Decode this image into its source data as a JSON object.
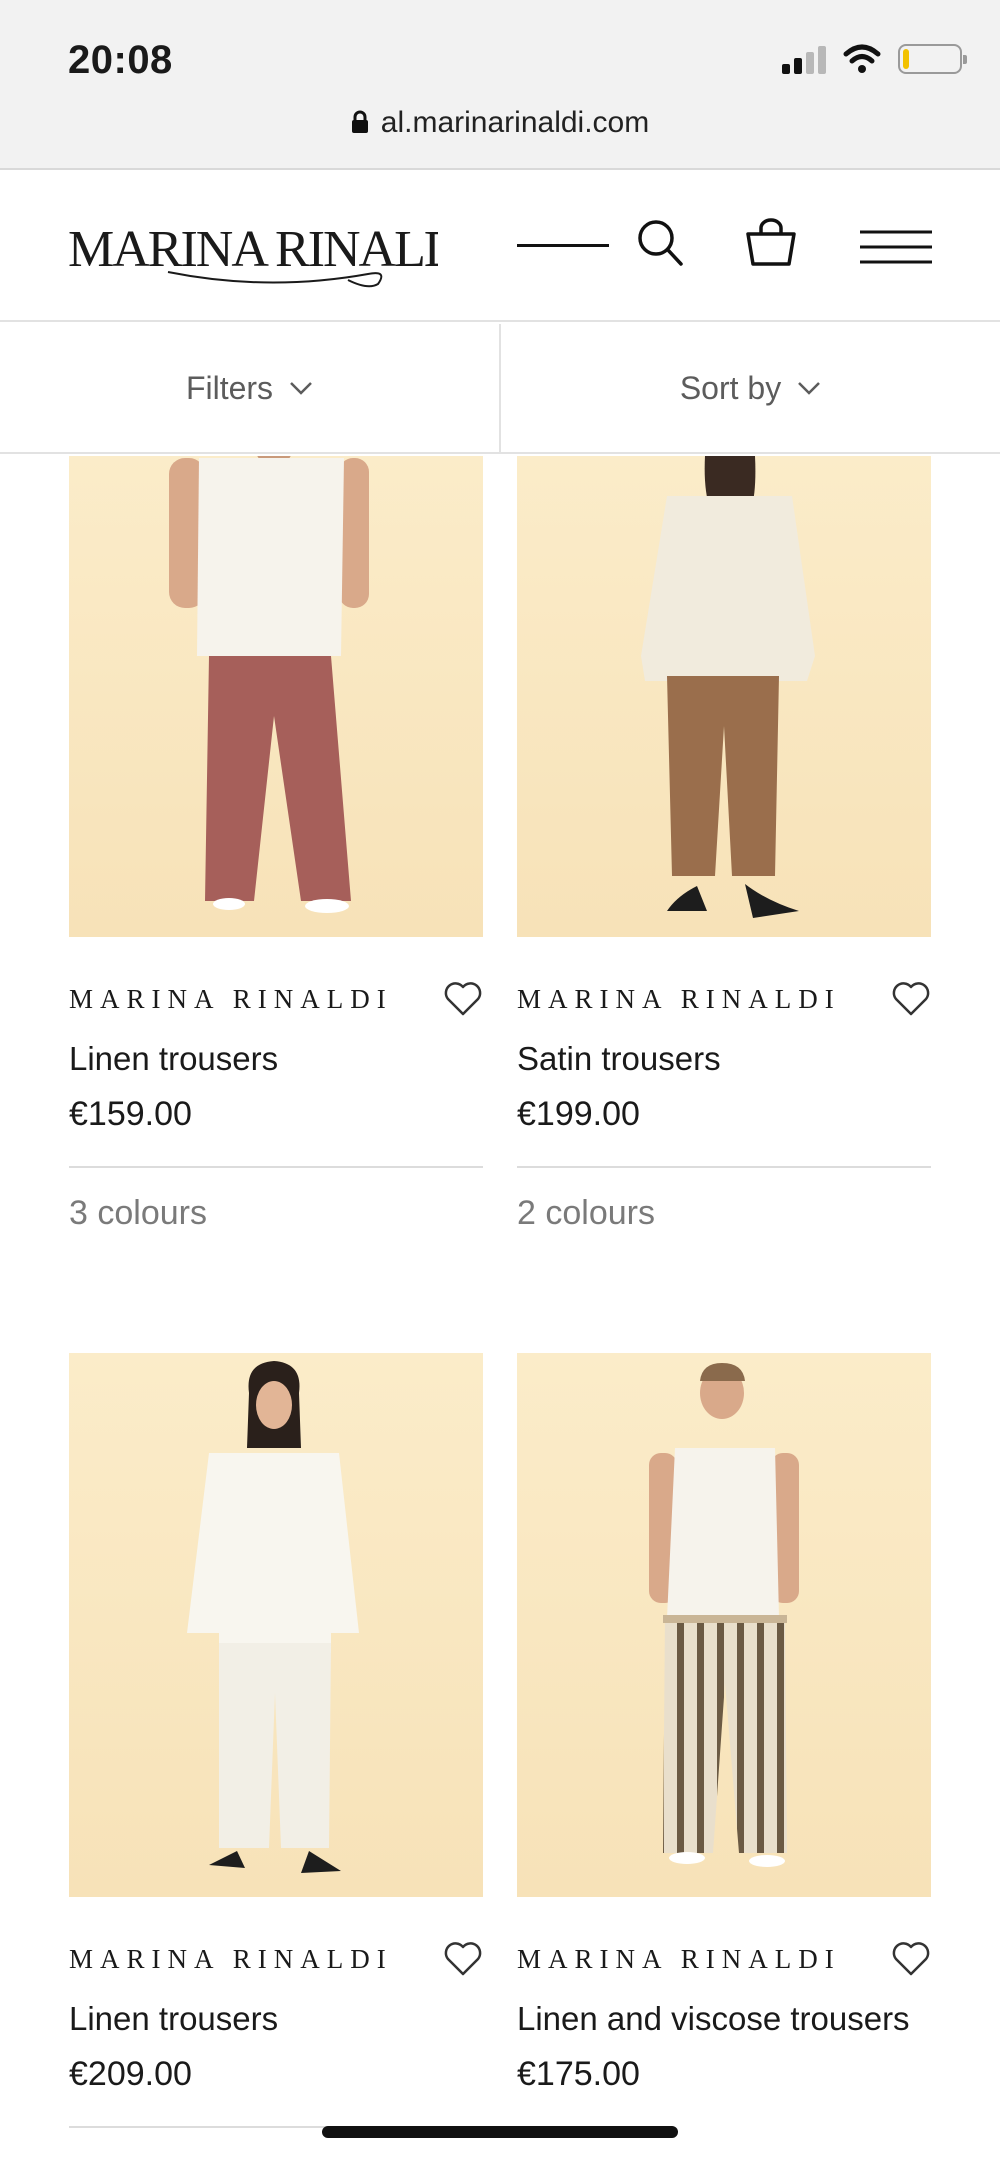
{
  "status_bar": {
    "time": "20:08"
  },
  "browser": {
    "url": "al.marinarinaldi.com"
  },
  "header": {
    "logo_text": "MARINA RINALDI",
    "icons": [
      "search-icon",
      "shopping-bag-icon",
      "menu-icon"
    ]
  },
  "filters": {
    "filters_label": "Filters",
    "sort_label": "Sort by"
  },
  "products": [
    {
      "brand": "MARINA RINALDI",
      "name": "Linen trousers",
      "price": "€159.00",
      "colours": "3 colours",
      "top_color": "#f6f3ec",
      "bottom_color": "#a65f5a"
    },
    {
      "brand": "MARINA RINALDI",
      "name": "Satin trousers",
      "price": "€199.00",
      "colours": "2 colours",
      "top_color": "#f1ebdd",
      "bottom_color": "#9a6e4c"
    },
    {
      "brand": "MARINA RINALDI",
      "name": "Linen trousers",
      "price": "€209.00",
      "top_color": "#f8f6ef",
      "bottom_color": "#f2efe6"
    },
    {
      "brand": "MARINA RINALDI",
      "name": "Linen and viscose trousers",
      "price": "€175.00",
      "top_color": "#f6f3ec",
      "bottom_color": "#c9b596"
    }
  ]
}
